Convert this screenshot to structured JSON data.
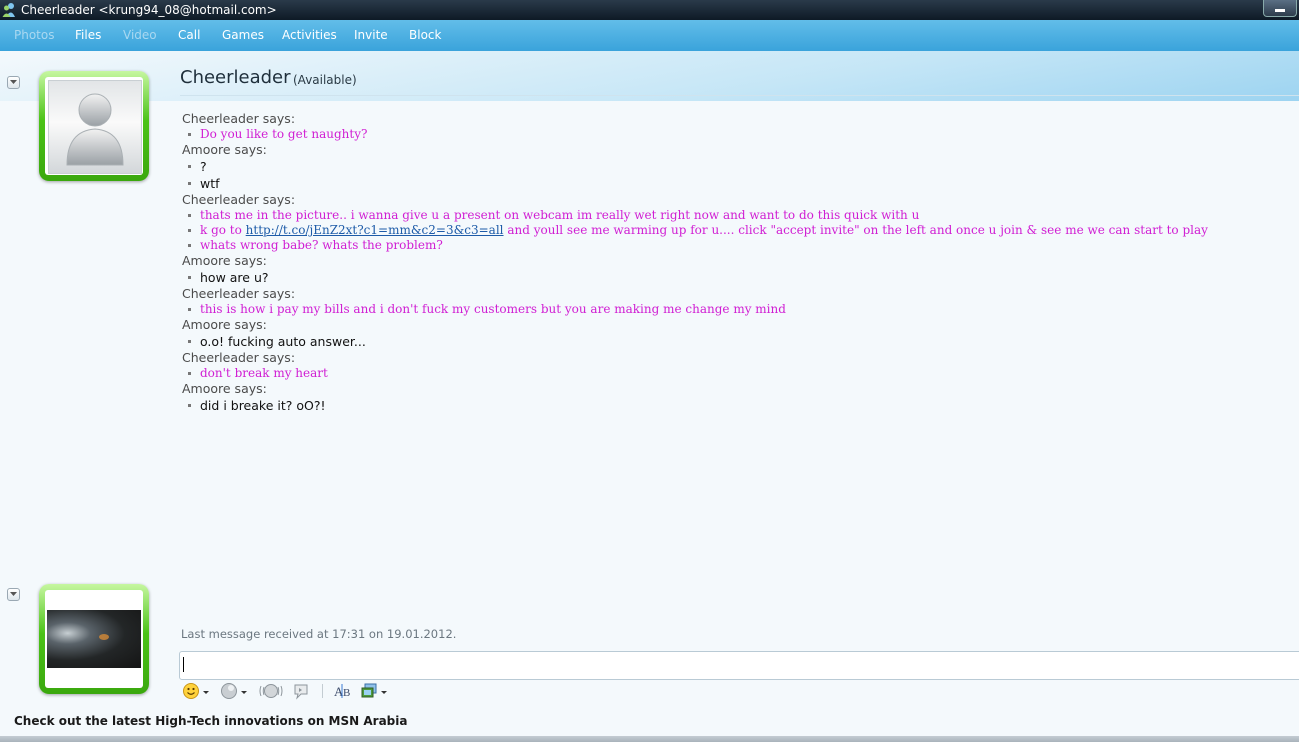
{
  "window": {
    "title": "Cheerleader <krung94_08@hotmail.com>"
  },
  "toolbar": {
    "items": [
      {
        "label": "Photos",
        "enabled": false
      },
      {
        "label": "Files",
        "enabled": true
      },
      {
        "label": "Video",
        "enabled": false
      },
      {
        "label": "Call",
        "enabled": true
      },
      {
        "label": "Games",
        "enabled": true
      },
      {
        "label": "Activities",
        "enabled": true
      },
      {
        "label": "Invite",
        "enabled": true
      },
      {
        "label": "Block",
        "enabled": true
      }
    ]
  },
  "contact": {
    "name": "Cheerleader",
    "status": "(Available)"
  },
  "conversation": [
    {
      "sender": "Cheerleader says:",
      "who": "cheer",
      "lines": [
        "Do you like to get naughty?"
      ]
    },
    {
      "sender": "Amoore says:",
      "who": "amoore",
      "lines": [
        "?",
        "wtf"
      ]
    },
    {
      "sender": "Cheerleader says:",
      "who": "cheer",
      "lines": [
        "thats me in the picture.. i wanna give u a present on webcam im really wet right now and want to do this quick with u",
        "LINK",
        "whats wrong babe? whats the problem?"
      ]
    },
    {
      "sender": "Amoore says:",
      "who": "amoore",
      "lines": [
        "how are u?"
      ]
    },
    {
      "sender": "Cheerleader says:",
      "who": "cheer",
      "lines": [
        "this is how i pay my bills and i don't fuck my customers but you are making me change my mind"
      ]
    },
    {
      "sender": "Amoore says:",
      "who": "amoore",
      "lines": [
        "o.o! fucking auto answer..."
      ]
    },
    {
      "sender": "Cheerleader says:",
      "who": "cheer",
      "lines": [
        "don't break my heart"
      ]
    },
    {
      "sender": "Amoore says:",
      "who": "amoore",
      "lines": [
        "did i breake it? oO?!"
      ]
    }
  ],
  "link_line": {
    "before": "k go to ",
    "url": "http://t.co/jEnZ2xt?c1=mm&c2=3&c3=all",
    "after": " and youll see me warming up for u.... click \"accept invite\" on the left and once u join & see me we can start to play"
  },
  "last_message": "Last message received at 17:31 on 19.01.2012.",
  "input": {
    "value": ""
  },
  "footer": {
    "ad_text": "Check out the latest High-Tech innovations on MSN Arabia"
  },
  "colors": {
    "toolbar": "#45aadf",
    "cheerleader_text": "#d01ed3",
    "link": "#1d5ba8",
    "avatar_frame": "#4bc317"
  },
  "icons": {
    "format_bar": [
      "emoticon-icon",
      "wink-icon",
      "nudge-icon",
      "voice-clip-icon",
      "font-icon",
      "background-icon"
    ]
  }
}
